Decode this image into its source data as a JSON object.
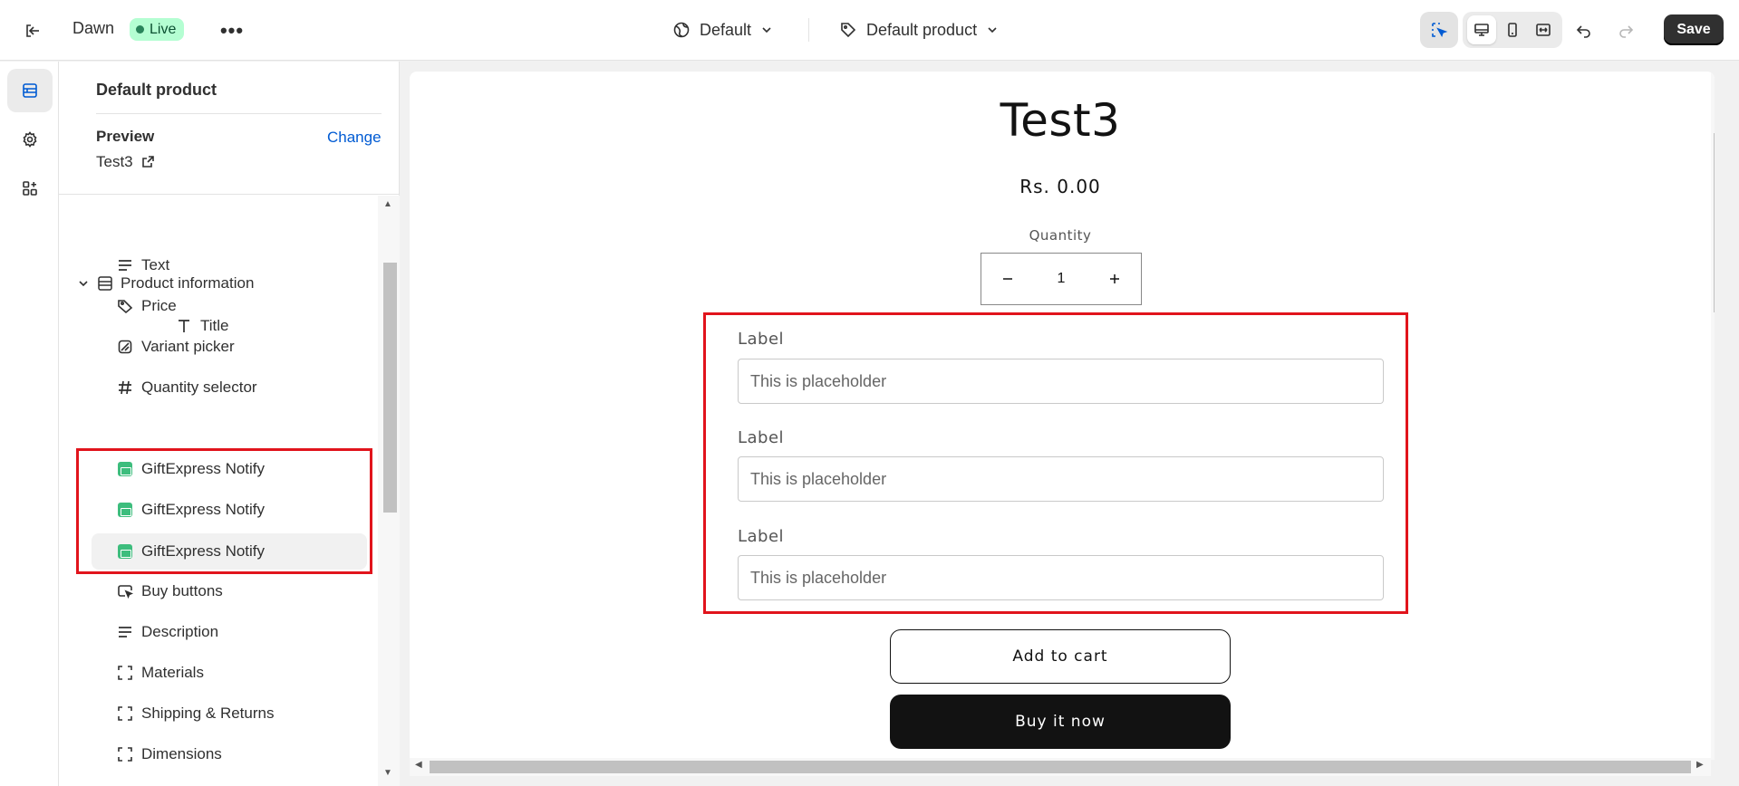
{
  "topbar": {
    "theme_name": "Dawn",
    "status_badge": "Live",
    "more_label": "•••",
    "template_select": "Default",
    "product_select": "Default product",
    "save_label": "Save"
  },
  "sidebar": {
    "title": "Default product",
    "preview_label": "Preview",
    "change_label": "Change",
    "preview_product": "Test3",
    "section": "Product information",
    "blocks": [
      {
        "label": "Title",
        "icon": "text-title-icon"
      },
      {
        "label": "Text",
        "icon": "text-align-icon"
      },
      {
        "label": "Price",
        "icon": "price-tag-icon"
      },
      {
        "label": "Variant picker",
        "icon": "variant-icon"
      },
      {
        "label": "Quantity selector",
        "icon": "hash-icon"
      },
      {
        "label": "GiftExpress Notify",
        "icon": "gift-app-icon"
      },
      {
        "label": "GiftExpress Notify",
        "icon": "gift-app-icon"
      },
      {
        "label": "GiftExpress Notify",
        "icon": "gift-app-icon"
      },
      {
        "label": "Buy buttons",
        "icon": "buy-buttons-icon"
      },
      {
        "label": "Description",
        "icon": "text-align-icon"
      },
      {
        "label": "Materials",
        "icon": "collapsible-icon"
      },
      {
        "label": "Shipping & Returns",
        "icon": "collapsible-icon"
      },
      {
        "label": "Dimensions",
        "icon": "collapsible-icon"
      }
    ]
  },
  "canvas": {
    "product_title": "Test3",
    "price": "Rs. 0.00",
    "quantity_label": "Quantity",
    "quantity_value": "1",
    "fields": [
      {
        "label": "Label",
        "placeholder": "This is placeholder"
      },
      {
        "label": "Label",
        "placeholder": "This is placeholder"
      },
      {
        "label": "Label",
        "placeholder": "This is placeholder"
      }
    ],
    "add_to_cart": "Add to cart",
    "buy_now": "Buy it now"
  },
  "colors": {
    "accent": "#005bd3",
    "live_bg": "#b4fed2",
    "highlight": "#e1141c",
    "app_icon": "#3dbd7d"
  }
}
